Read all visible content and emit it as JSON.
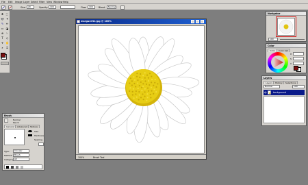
{
  "menubar": {
    "items": [
      "File",
      "Edit",
      "Image",
      "Layer",
      "Select",
      "Filter",
      "View",
      "Window",
      "Help"
    ]
  },
  "options_bar": {
    "size_label": "Size:",
    "size_value": "20",
    "opacity_label": "Opacity:",
    "opacity_value": "100",
    "flow_label": "Flow:",
    "flow_value": "100",
    "blend_label": "Blend:",
    "blend_value": "Normal"
  },
  "document": {
    "title": "marguerite.jpg @ 100%",
    "zoom": "100%",
    "status_tool": "Brush Tool"
  },
  "navigator": {
    "title": "Navigator",
    "zoom_value": "100"
  },
  "color": {
    "title": "Color",
    "tabs": [
      "Color",
      "Color Set"
    ],
    "h_label": "H",
    "s_label": "S",
    "v_label": "V",
    "fg_color": "#7a1010",
    "bg_color": "#ffffff"
  },
  "layers": {
    "title": "Layers",
    "tabs": [
      "Layers",
      "History",
      "Selections"
    ],
    "blend_mode": "Normal",
    "opacity": "100",
    "rows": [
      {
        "name": "background",
        "selected": true
      }
    ]
  },
  "brush": {
    "title": "Brush",
    "tabs": [
      "General",
      "Advanced",
      "Texture"
    ],
    "size_label": "Size",
    "hardness_label": "Hardness",
    "spacing_label": "Spacing",
    "opt1": "Normal",
    "opt2": "Pencil",
    "type_label": "Type:",
    "type_value": "Circular",
    "method_label": "Method:",
    "method_value": "Brush",
    "category_label": "Category:",
    "category_value": "All"
  },
  "colors": {
    "accent_titlebar": "#0a2a8a",
    "petal": "#ffffff",
    "center": "#e3c810",
    "workspace": "#7e7e7e"
  }
}
